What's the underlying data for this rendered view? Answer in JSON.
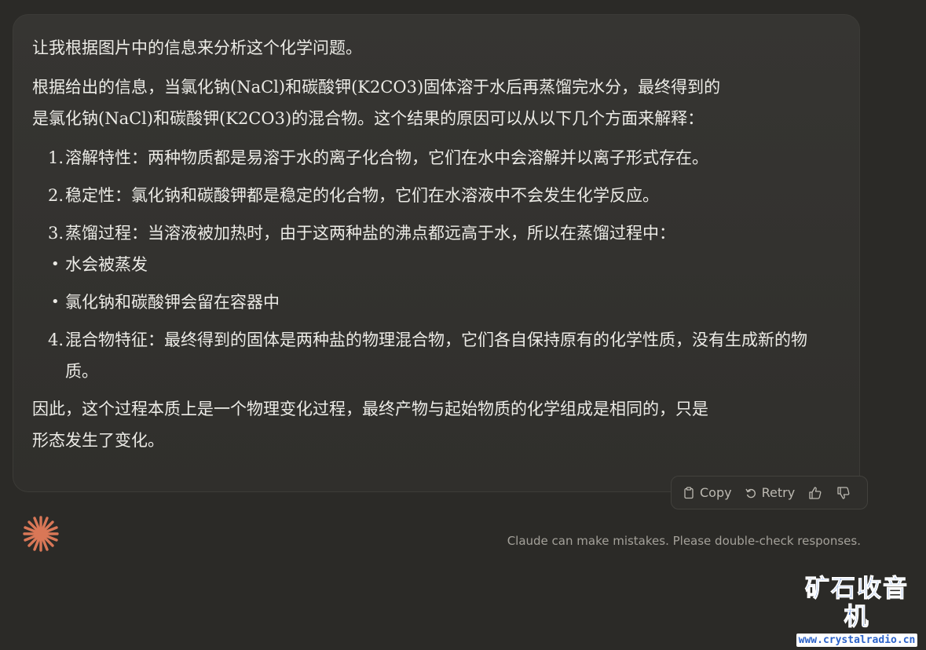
{
  "message": {
    "intro": "让我根据图片中的信息来分析这个化学问题。",
    "para1_line1": "根据给出的信息，当氯化钠(NaCl)和碳酸钾(K2CO3)固体溶于水后再蒸馏完水分，最终得到的",
    "para1_line2": "是氯化钠(NaCl)和碳酸钾(K2CO3)的混合物。这个结果的原因可以从以下几个方面来解释：",
    "steps": [
      {
        "num": "1.",
        "text": "溶解特性：两种物质都是易溶于水的离子化合物，它们在水中会溶解并以离子形式存在。"
      },
      {
        "num": "2.",
        "text": "稳定性：氯化钠和碳酸钾都是稳定的化合物，它们在水溶液中不会发生化学反应。"
      },
      {
        "num": "3.",
        "text": "蒸馏过程：当溶液被加热时，由于这两种盐的沸点都远高于水，所以在蒸馏过程中："
      },
      {
        "num": "4.",
        "text": "混合物特征：最终得到的固体是两种盐的物理混合物，它们各自保持原有的化学性质，没有生成新的物质。"
      }
    ],
    "sub_items": [
      "水会被蒸发",
      "氯化钠和碳酸钾会留在容器中"
    ],
    "conclusion_line1": "因此，这个过程本质上是一个物理变化过程，最终产物与起始物质的化学组成是相同的，只是",
    "conclusion_line2": "形态发生了变化。"
  },
  "actions": {
    "copy_label": "Copy",
    "retry_label": "Retry"
  },
  "footer": {
    "disclaimer": "Claude can make mistakes. Please double-check responses."
  },
  "watermark": {
    "title": "矿石收音机",
    "url": "www.crystalradio.cn"
  },
  "colors": {
    "background": "#2b2a27",
    "bubble": "#33322f",
    "text": "#ecebe6",
    "logo": "#d97757",
    "watermark": "#2b62c9"
  }
}
